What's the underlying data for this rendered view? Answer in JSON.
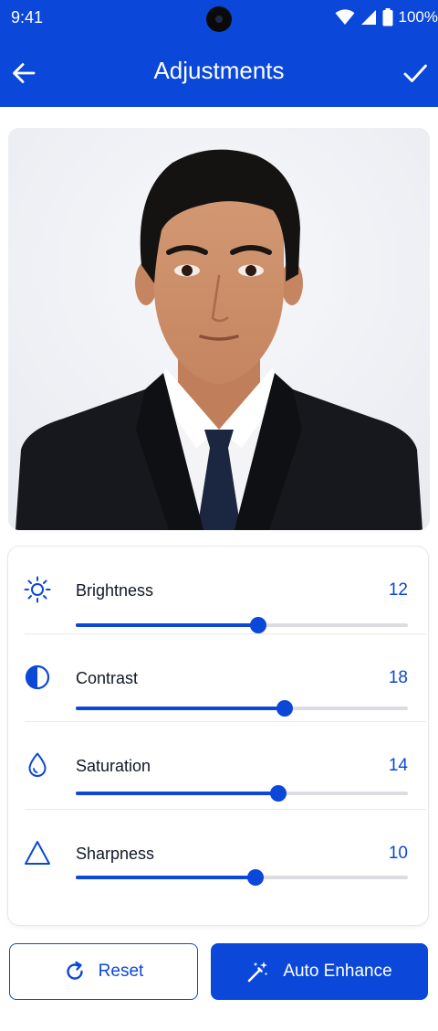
{
  "status_bar": {
    "time": "9:41",
    "battery": "100%",
    "icons": [
      "wifi-icon",
      "cellular-signal-icon",
      "battery-icon"
    ]
  },
  "app_bar": {
    "title": "Adjustments",
    "back_icon": "arrow-left-icon",
    "confirm_icon": "checkmark-icon"
  },
  "adjustments": [
    {
      "label": "Brightness",
      "value": "12",
      "icon": "sun-icon",
      "slider_fraction": 0.55
    },
    {
      "label": "Contrast",
      "value": "18",
      "icon": "contrast-icon",
      "slider_fraction": 0.63
    },
    {
      "label": "Saturation",
      "value": "14",
      "icon": "droplet-icon",
      "slider_fraction": 0.61
    },
    {
      "label": "Sharpness",
      "value": "10",
      "icon": "triangle-icon",
      "slider_fraction": 0.54
    }
  ],
  "buttons": {
    "reset": {
      "label": "Reset",
      "icon": "refresh-icon"
    },
    "auto_enhance": {
      "label": "Auto Enhance",
      "icon": "magic-wand-icon"
    }
  },
  "colors": {
    "accent": "#0b47d9",
    "track": "#dcdde2"
  }
}
